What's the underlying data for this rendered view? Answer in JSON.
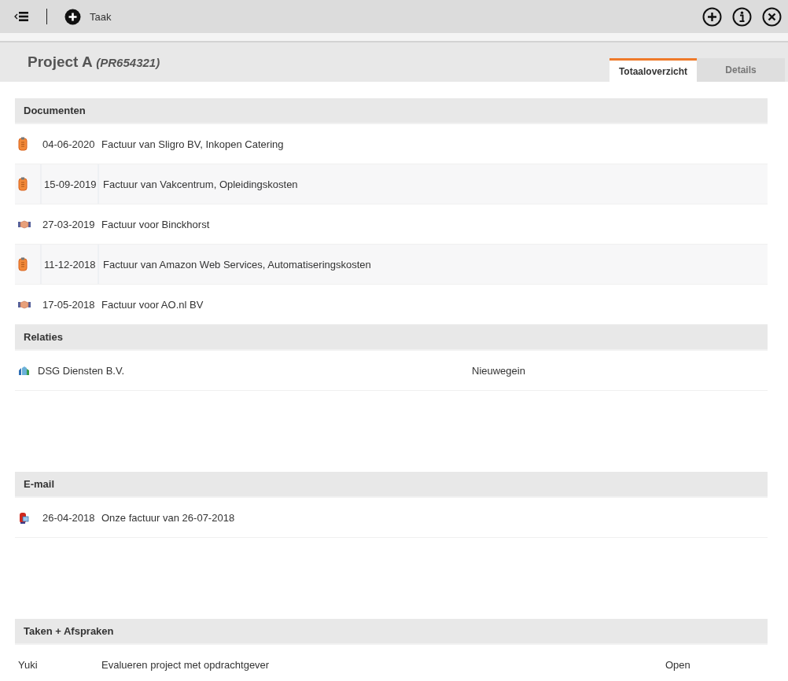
{
  "toolbar": {
    "new_task_label": "Taak"
  },
  "header": {
    "title": "Project A",
    "code": "(PR654321)"
  },
  "tabs": [
    {
      "label": "Totaaloverzicht",
      "selected": true
    },
    {
      "label": "Details",
      "selected": false
    }
  ],
  "documents": {
    "title": "Documenten",
    "rows": [
      {
        "kind": "invoice",
        "date": "04-06-2020",
        "description": "Factuur van Sligro BV, Inkopen Catering"
      },
      {
        "kind": "invoice",
        "date": "15-09-2019",
        "description": "Factuur van Vakcentrum, Opleidingskosten"
      },
      {
        "kind": "handshake",
        "date": "27-03-2019",
        "description": "Factuur voor Binckhorst"
      },
      {
        "kind": "invoice",
        "date": "11-12-2018",
        "description": "Factuur van Amazon Web Services, Automatiseringskosten"
      },
      {
        "kind": "handshake",
        "date": "17-05-2018",
        "description": "Factuur voor AO.nl BV"
      }
    ]
  },
  "relations": {
    "title": "Relaties",
    "rows": [
      {
        "name": "DSG Diensten B.V.",
        "city": "Nieuwegein"
      }
    ]
  },
  "email": {
    "title": "E-mail",
    "rows": [
      {
        "date": "26-04-2018",
        "subject": "Onze factuur van 26-07-2018"
      }
    ]
  },
  "tasks": {
    "title": "Taken + Afspraken",
    "rows": [
      {
        "person": "Yuki",
        "description": "Evalueren project met opdrachtgever",
        "status": "Open"
      }
    ]
  }
}
